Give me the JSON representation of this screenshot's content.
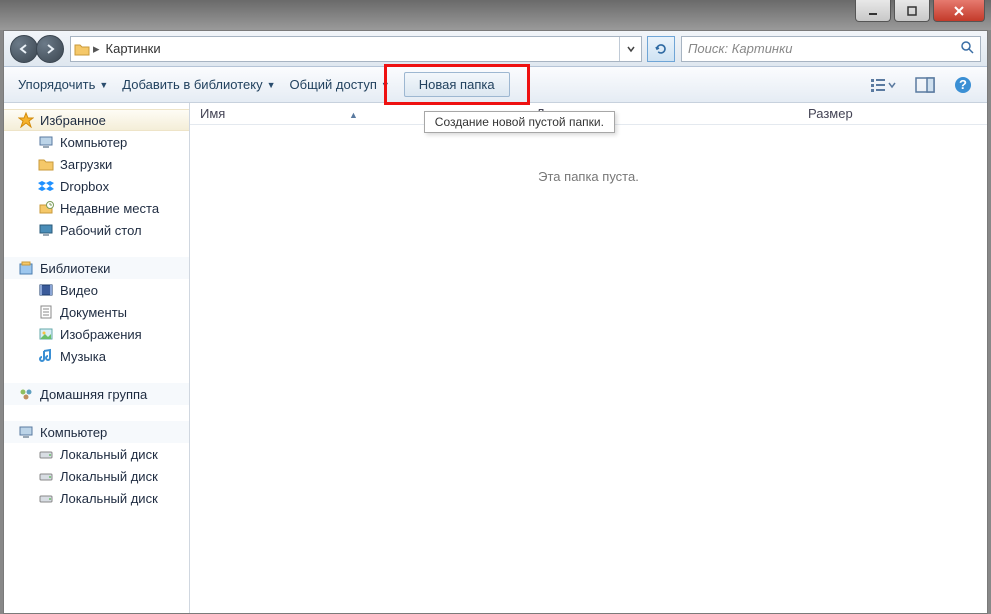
{
  "address": {
    "location": "Картинки"
  },
  "search": {
    "placeholder": "Поиск: Картинки"
  },
  "toolbar": {
    "organize": "Упорядочить",
    "addToLibrary": "Добавить в библиотеку",
    "share": "Общий доступ",
    "newFolder": "Новая папка"
  },
  "tooltip": {
    "newFolder": "Создание новой пустой папки."
  },
  "columns": {
    "name": "Имя",
    "date": "Дат",
    "size": "Размер"
  },
  "content": {
    "emptyMessage": "Эта папка пуста."
  },
  "sidebar": {
    "favorites": {
      "label": "Избранное",
      "items": [
        {
          "label": "Компьютер",
          "icon": "computer"
        },
        {
          "label": "Загрузки",
          "icon": "folder"
        },
        {
          "label": "Dropbox",
          "icon": "dropbox"
        },
        {
          "label": "Недавние места",
          "icon": "recent"
        },
        {
          "label": "Рабочий стол",
          "icon": "desktop"
        }
      ]
    },
    "libraries": {
      "label": "Библиотеки",
      "items": [
        {
          "label": "Видео",
          "icon": "video"
        },
        {
          "label": "Документы",
          "icon": "doc"
        },
        {
          "label": "Изображения",
          "icon": "image"
        },
        {
          "label": "Музыка",
          "icon": "music"
        }
      ]
    },
    "homegroup": {
      "label": "Домашняя группа"
    },
    "computer": {
      "label": "Компьютер",
      "items": [
        {
          "label": "Локальный диск",
          "icon": "drive"
        },
        {
          "label": "Локальный диск",
          "icon": "drive"
        },
        {
          "label": "Локальный диск",
          "icon": "drive"
        }
      ]
    }
  }
}
